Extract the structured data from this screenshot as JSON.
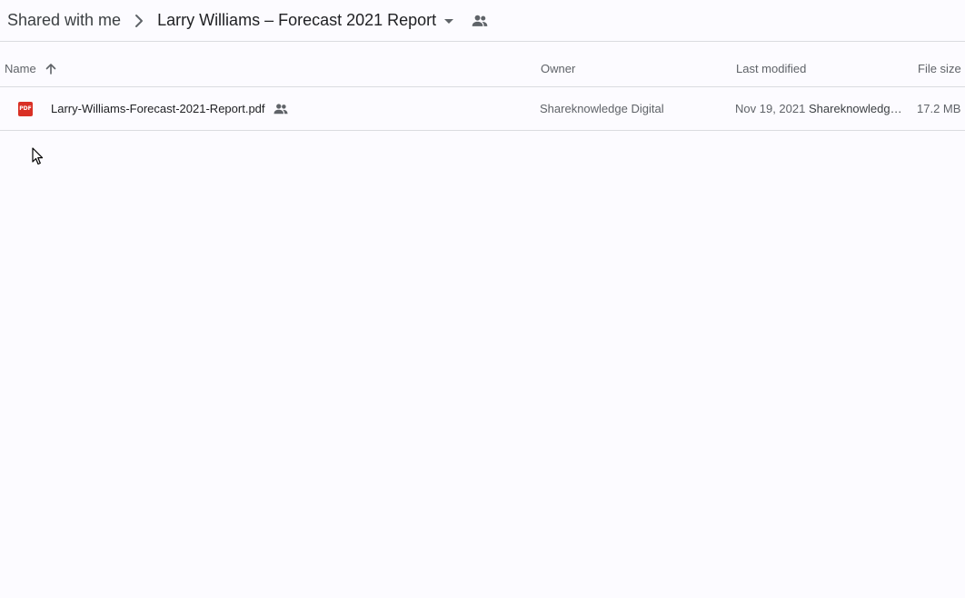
{
  "breadcrumb": {
    "root_label": "Shared with me",
    "current_label": "Larry Williams – Forecast 2021 Report",
    "separator_icon": "chevron-right-icon",
    "dropdown_icon": "caret-down-icon",
    "shared_icon": "people-icon"
  },
  "columns": {
    "name": "Name",
    "owner": "Owner",
    "last_modified": "Last modified",
    "file_size": "File size",
    "sort_icon": "arrow-up-icon"
  },
  "files": [
    {
      "type_icon": "pdf-icon",
      "type_badge": "PDF",
      "name": "Larry-Williams-Forecast-2021-Report.pdf",
      "shared_icon": "people-icon",
      "owner": "Shareknowledge Digital",
      "modified_date": "Nov 19, 2021",
      "modified_by": "Shareknowledge Digital",
      "size": "17.2 MB"
    }
  ],
  "colors": {
    "background": "#fcfbff",
    "divider": "#dadce0",
    "pdf_red": "#d93025",
    "text_primary": "#202124",
    "text_secondary": "#5f6368"
  }
}
